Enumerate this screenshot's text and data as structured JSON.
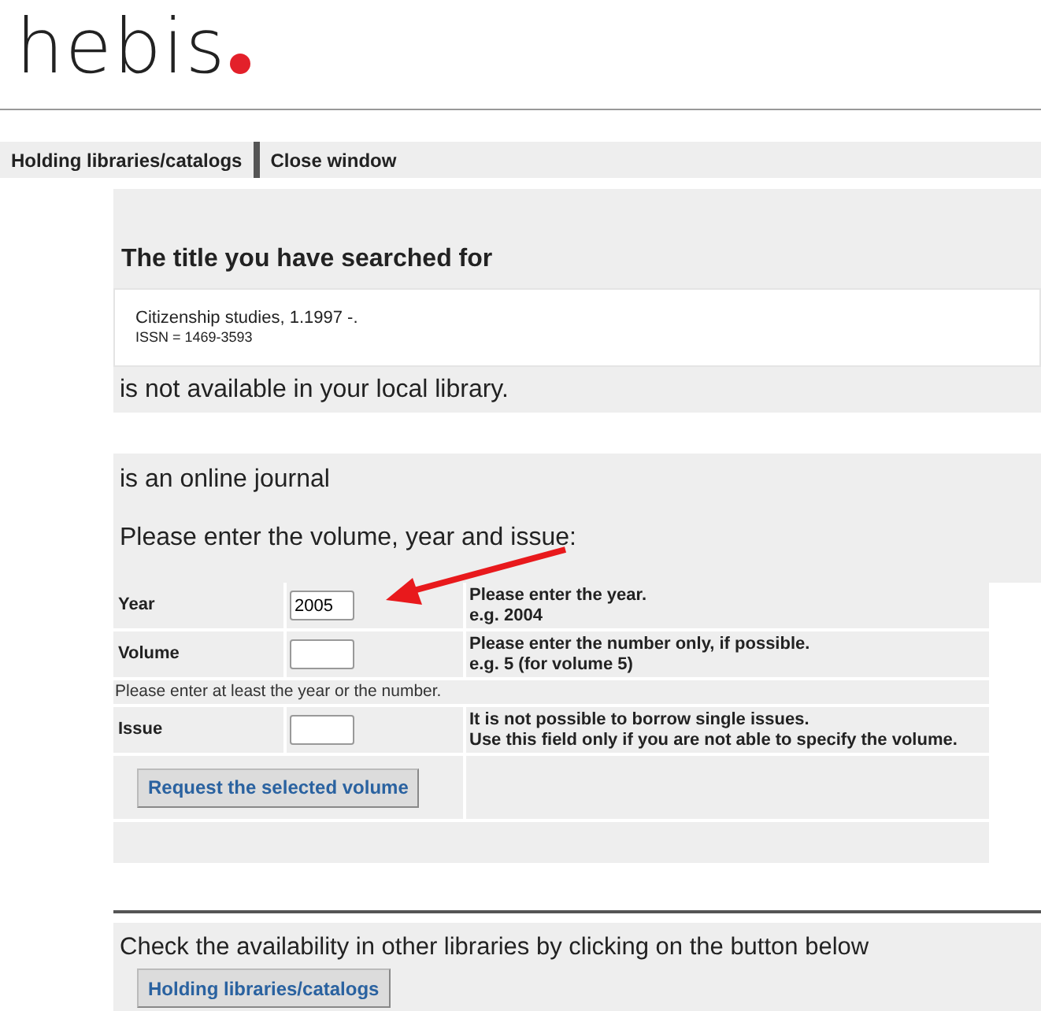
{
  "logo": {
    "text": "hebis"
  },
  "nav": [
    {
      "label": "Holding libraries/catalogs"
    },
    {
      "label": "Close window"
    }
  ],
  "title_heading": "The title you have searched for",
  "record": {
    "title": "Citizenship studies, 1.1997 -.",
    "issn": "ISSN = 1469-3593"
  },
  "availability": "is not available in your local library.",
  "online_note": "is an online journal",
  "form_heading": "Please enter the volume, year and issue:",
  "rows": [
    {
      "kind": "field",
      "label": "Year",
      "value": "2005",
      "hint": [
        "Please enter the year.",
        "e.g. 2004"
      ]
    },
    {
      "kind": "field",
      "label": "Volume",
      "hint": [
        "Please enter the number only, if possible.",
        "e.g. 5 (for volume 5)"
      ]
    },
    {
      "kind": "note",
      "text": "Please enter at least the year or the number."
    },
    {
      "kind": "field",
      "label": "Issue",
      "hint": [
        "It is not possible to borrow single issues.",
        "Use this field only if you are not able to specify the volume."
      ]
    }
  ],
  "request_button": "Request the selected volume",
  "other_libraries": {
    "text": "Check the availability in other libraries by clicking on the button below",
    "button": "Holding libraries/catalogs"
  }
}
